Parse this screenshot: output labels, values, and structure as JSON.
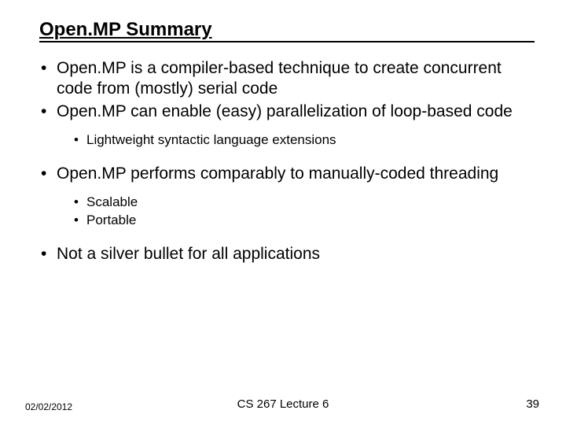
{
  "title": "Open.MP Summary",
  "bullets": {
    "b1": "Open.MP is a compiler-based technique to create concurrent code from (mostly) serial code",
    "b2": "Open.MP can enable (easy) parallelization of loop-based code",
    "b2_sub1": "Lightweight syntactic language extensions",
    "b3": "Open.MP performs comparably to manually-coded threading",
    "b3_sub1": "Scalable",
    "b3_sub2": "Portable",
    "b4": "Not a silver bullet for all applications"
  },
  "footer": {
    "date": "02/02/2012",
    "center": "CS 267 Lecture 6",
    "page": "39"
  }
}
